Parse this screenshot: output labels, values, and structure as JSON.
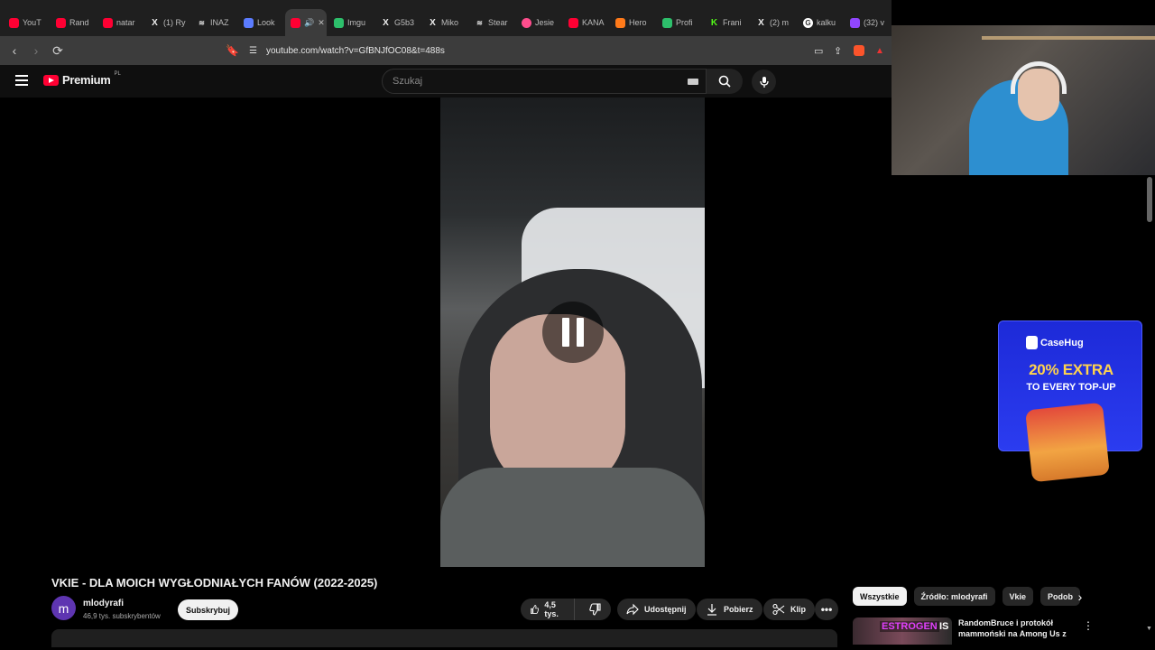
{
  "browser": {
    "tabs": [
      {
        "label": "YouT",
        "icon": "youtube-icon"
      },
      {
        "label": "Rand",
        "icon": "youtube-icon"
      },
      {
        "label": "natar",
        "icon": "youtube-icon"
      },
      {
        "label": "(1) Ry",
        "icon": "x-icon"
      },
      {
        "label": "INAZ",
        "icon": "layers-icon"
      },
      {
        "label": "Look",
        "icon": "app-icon"
      },
      {
        "label": "",
        "icon": "youtube-icon",
        "active": true
      },
      {
        "label": "Imgu",
        "icon": "imgur-icon"
      },
      {
        "label": "G5b3",
        "icon": "x-icon"
      },
      {
        "label": "Miko",
        "icon": "x-icon"
      },
      {
        "label": "Stear",
        "icon": "layers-icon"
      },
      {
        "label": "Jesie",
        "icon": "pink-icon"
      },
      {
        "label": "KANA",
        "icon": "youtube-icon"
      },
      {
        "label": "Hero",
        "icon": "orange-icon"
      },
      {
        "label": "Profi",
        "icon": "green-icon"
      },
      {
        "label": "Frani",
        "icon": "kick-icon"
      },
      {
        "label": "(2) m",
        "icon": "x-icon"
      },
      {
        "label": "kalku",
        "icon": "google-icon"
      },
      {
        "label": "(32) v",
        "icon": "twitch-icon"
      }
    ],
    "url": "youtube.com/watch?v=GfBNJfOC08&t=488s"
  },
  "youtube": {
    "logo_text": "Premium",
    "logo_country": "PL",
    "search_placeholder": "Szukaj"
  },
  "video": {
    "title": "VKIE - DLA MOICH WYGŁODNIAŁYCH FANÓW (2022-2025)",
    "channel_initial": "m",
    "channel_name": "mlodyrafi",
    "subscribers": "46,9 tys. subskrybentów",
    "subscribe_label": "Subskrybuj",
    "likes": "4,5 tys.",
    "share_label": "Udostępnij",
    "download_label": "Pobierz",
    "clip_label": "Klip"
  },
  "ad": {
    "brand": "CaseHug",
    "line1": "20% EXTRA",
    "line2": "TO EVERY TOP-UP"
  },
  "sidebar": {
    "chips": [
      "Wszystkie",
      "Źródło: mlodyrafi",
      "Vkie",
      "Podob"
    ],
    "rec_thumb_tag": "ESTROGEN",
    "rec_thumb_tag2": "IS",
    "rec_title": "RandomBruce i protokół mammoński na Among Us z"
  },
  "colors": {
    "accent": "#ff0033",
    "ad_bg": "#2b3cf0",
    "ad_highlight": "#ffd34d"
  }
}
